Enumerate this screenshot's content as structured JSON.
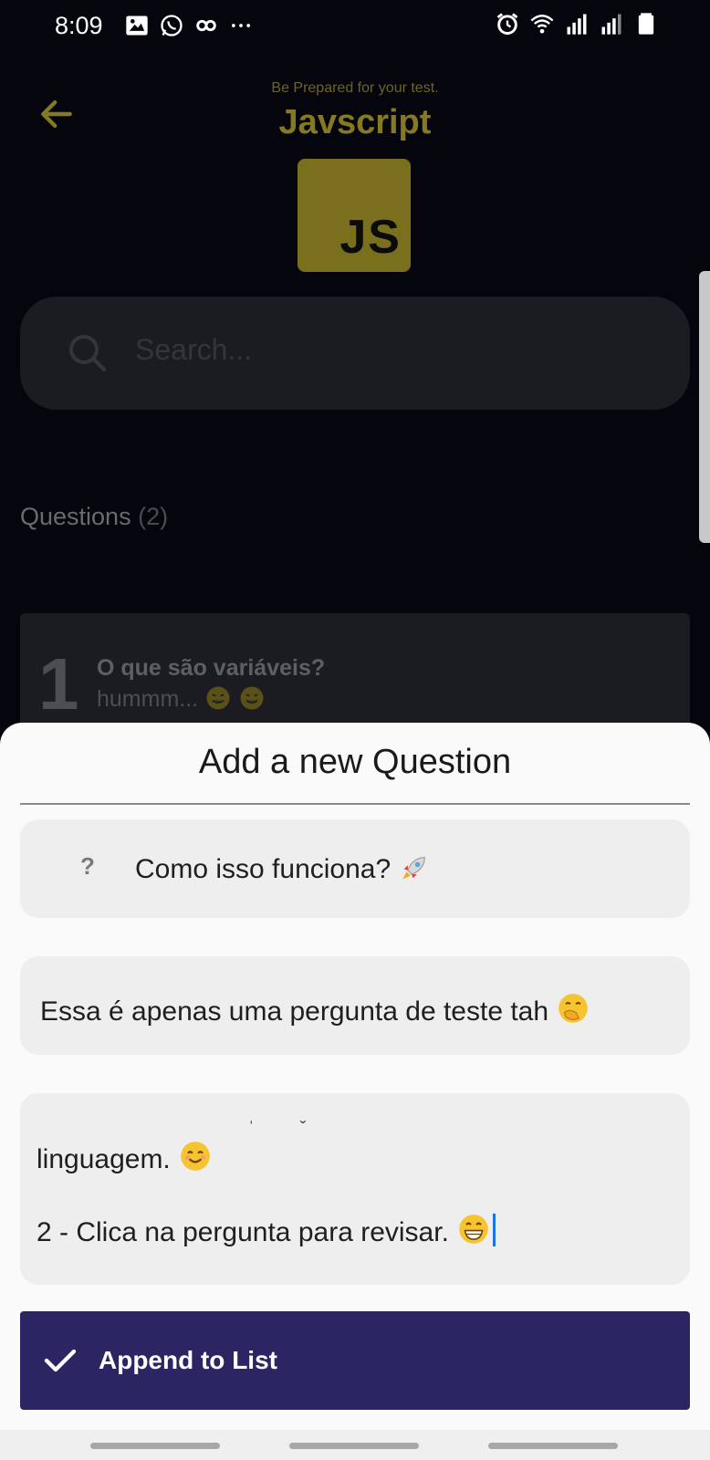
{
  "status_bar": {
    "time": "8:09",
    "left_icons": [
      "image-icon",
      "whatsapp-icon",
      "link-icon",
      "more-icon"
    ],
    "right_icons": [
      "alarm-icon",
      "wifi-icon",
      "signal-icon",
      "signal-icon",
      "battery-icon"
    ]
  },
  "header": {
    "subtitle": "Be Prepared for your test.",
    "title": "Javscript",
    "logo_text": "JS"
  },
  "search": {
    "placeholder": "Search..."
  },
  "questions": {
    "label": "Questions",
    "count": "(2)",
    "items": [
      {
        "number": "1",
        "title": "O que são variáveis?",
        "description": "hummm..."
      }
    ]
  },
  "sheet": {
    "title": "Add a new Question",
    "question_icon": "?",
    "question_value": "Como isso funciona?",
    "description_value": "Essa é apenas uma pergunta de teste tah",
    "answer_line_1": "linguagem.",
    "answer_line_2": "2 - Clica na pergunta para revisar.",
    "append_label": "Append to List"
  },
  "colors": {
    "background": "#05060d",
    "accent_gold": "#857a22",
    "sheet_bg": "#fafafa",
    "button_bg": "#2c2563",
    "field_bg": "#eeeeee"
  }
}
